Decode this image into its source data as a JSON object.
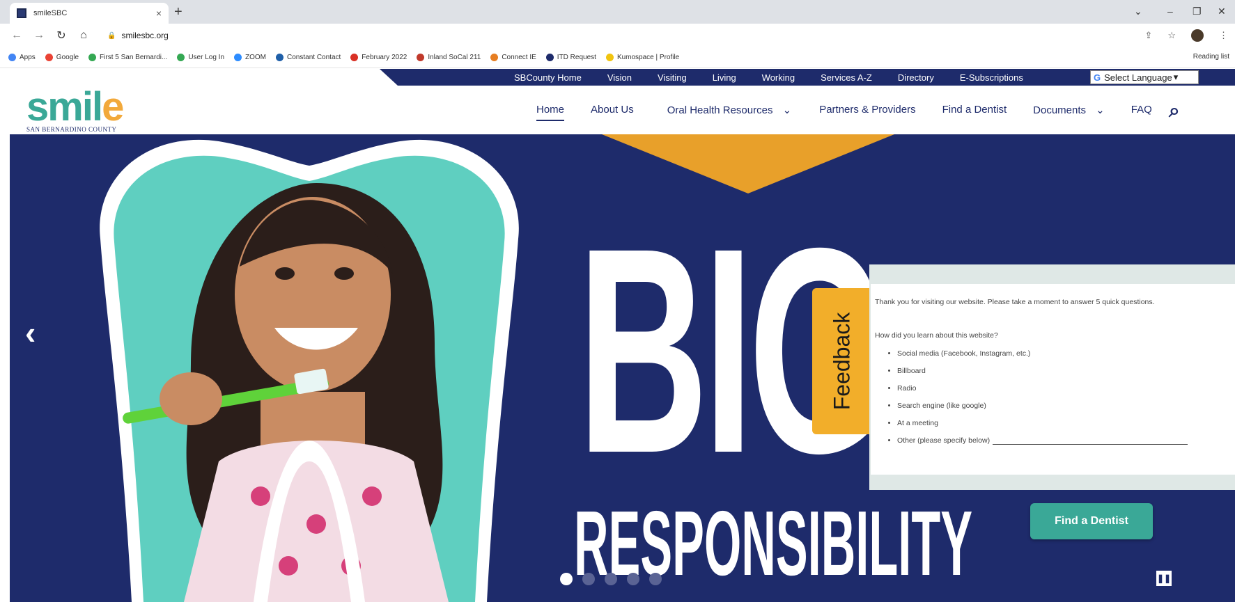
{
  "browser": {
    "tab_title": "smileSBC",
    "tab_close": "×",
    "new_tab": "+",
    "url": "smilesbc.org",
    "bookmarks": [
      {
        "label": "Apps",
        "color": "#4285f4"
      },
      {
        "label": "Google",
        "color": "#ea4335"
      },
      {
        "label": "First 5 San Bernardi...",
        "color": "#34a853"
      },
      {
        "label": "User Log In",
        "color": "#34a853"
      },
      {
        "label": "ZOOM",
        "color": "#2d8cff"
      },
      {
        "label": "Constant Contact",
        "color": "#1f5fa8"
      },
      {
        "label": "February 2022",
        "color": "#d93025"
      },
      {
        "label": "Inland SoCal 211",
        "color": "#c0392b"
      },
      {
        "label": "Connect IE",
        "color": "#e67e22"
      },
      {
        "label": "ITD Request",
        "color": "#1e2b6b"
      },
      {
        "label": "Kumospace | Profile",
        "color": "#f1c40f"
      }
    ],
    "reading_list": "Reading list"
  },
  "site": {
    "utility_links": [
      "SBCounty Home",
      "Vision",
      "Visiting",
      "Living",
      "Working",
      "Services A-Z",
      "Directory",
      "E-Subscriptions"
    ],
    "language": "Select Language",
    "logo_text_a": "smil",
    "logo_text_b": "e",
    "logo_sub": "SAN BERNARDINO COUNTY",
    "nav": [
      {
        "label": "Home",
        "dropdown": false,
        "active": true
      },
      {
        "label": "About Us",
        "dropdown": false
      },
      {
        "label": "Oral Health Resources",
        "dropdown": true
      },
      {
        "label": "Partners & Providers",
        "dropdown": false
      },
      {
        "label": "Find a Dentist",
        "dropdown": false
      },
      {
        "label": "Documents",
        "dropdown": true
      },
      {
        "label": "FAQ",
        "dropdown": false
      }
    ]
  },
  "hero": {
    "big_word": "BIG",
    "subtitle": "RESPONSIBILITY",
    "cta": "Find a Dentist",
    "slides": 5,
    "active_slide": 0
  },
  "feedback": {
    "tab_label": "Feedback",
    "intro": "Thank you for visiting our website.  Please take a moment to answer 5 quick questions.",
    "question": "How did you learn about this website?",
    "options": [
      "Social media (Facebook, Instagram, etc.)",
      "Billboard",
      "Radio",
      "Search engine (like google)",
      "At a meeting",
      "Other (please specify below)"
    ]
  },
  "colors": {
    "navy": "#1e2b6b",
    "teal": "#3aa897",
    "gold": "#f2ae2a"
  }
}
